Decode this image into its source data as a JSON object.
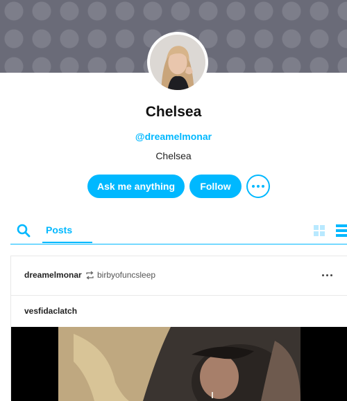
{
  "profile": {
    "title": "Chelsea",
    "handle": "@dreamelmonar",
    "description": "Chelsea"
  },
  "actions": {
    "ask_label": "Ask me anything",
    "follow_label": "Follow",
    "more_icon": "ellipsis-icon"
  },
  "tabs": {
    "search_icon": "search-icon",
    "posts_label": "Posts",
    "grid_view_icon": "grid-icon",
    "list_view_icon": "list-icon"
  },
  "post": {
    "author": "dreamelmonar",
    "reblog_icon": "reblog-icon",
    "reblogged_from": "birbyofuncsleep",
    "body_author": "vesfidaclatch",
    "more_icon": "ellipsis-icon"
  },
  "colors": {
    "accent": "#00b8ff",
    "banner": "#6a6b78",
    "text": "#111111"
  }
}
